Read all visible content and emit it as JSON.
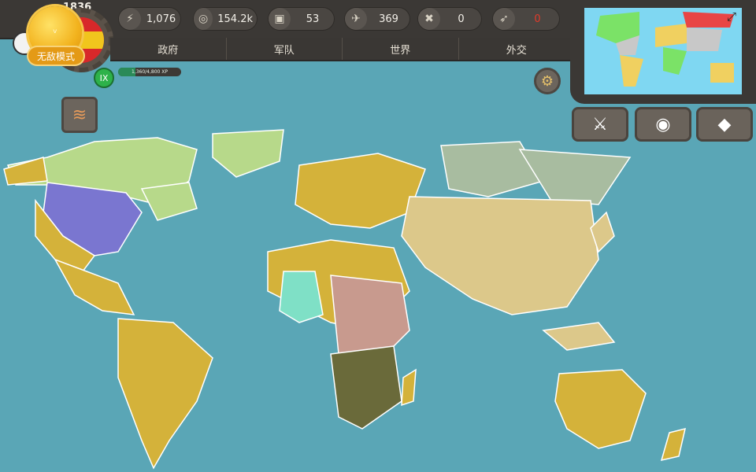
{
  "game": {
    "year": "1836",
    "mode_label": "无敌模式",
    "rank": "IX"
  },
  "xp": {
    "label": "1,360/4,800 XP",
    "fraction": 0.28
  },
  "resources": [
    {
      "icon": "lightning-icon",
      "value": "1,076"
    },
    {
      "icon": "coins-icon",
      "value": "154.2k"
    },
    {
      "icon": "crate-icon",
      "value": "53"
    },
    {
      "icon": "wing-icon",
      "value": "369"
    },
    {
      "icon": "crossed-swords-icon",
      "value": "0"
    },
    {
      "icon": "missile-icon",
      "value": "0"
    }
  ],
  "nav": {
    "tabs": [
      "政府",
      "军队",
      "世界",
      "外交"
    ]
  },
  "colors": {
    "ocean": "#5aa6b6",
    "player": "#d8b63a",
    "resource_alert": "#e23a2a"
  }
}
